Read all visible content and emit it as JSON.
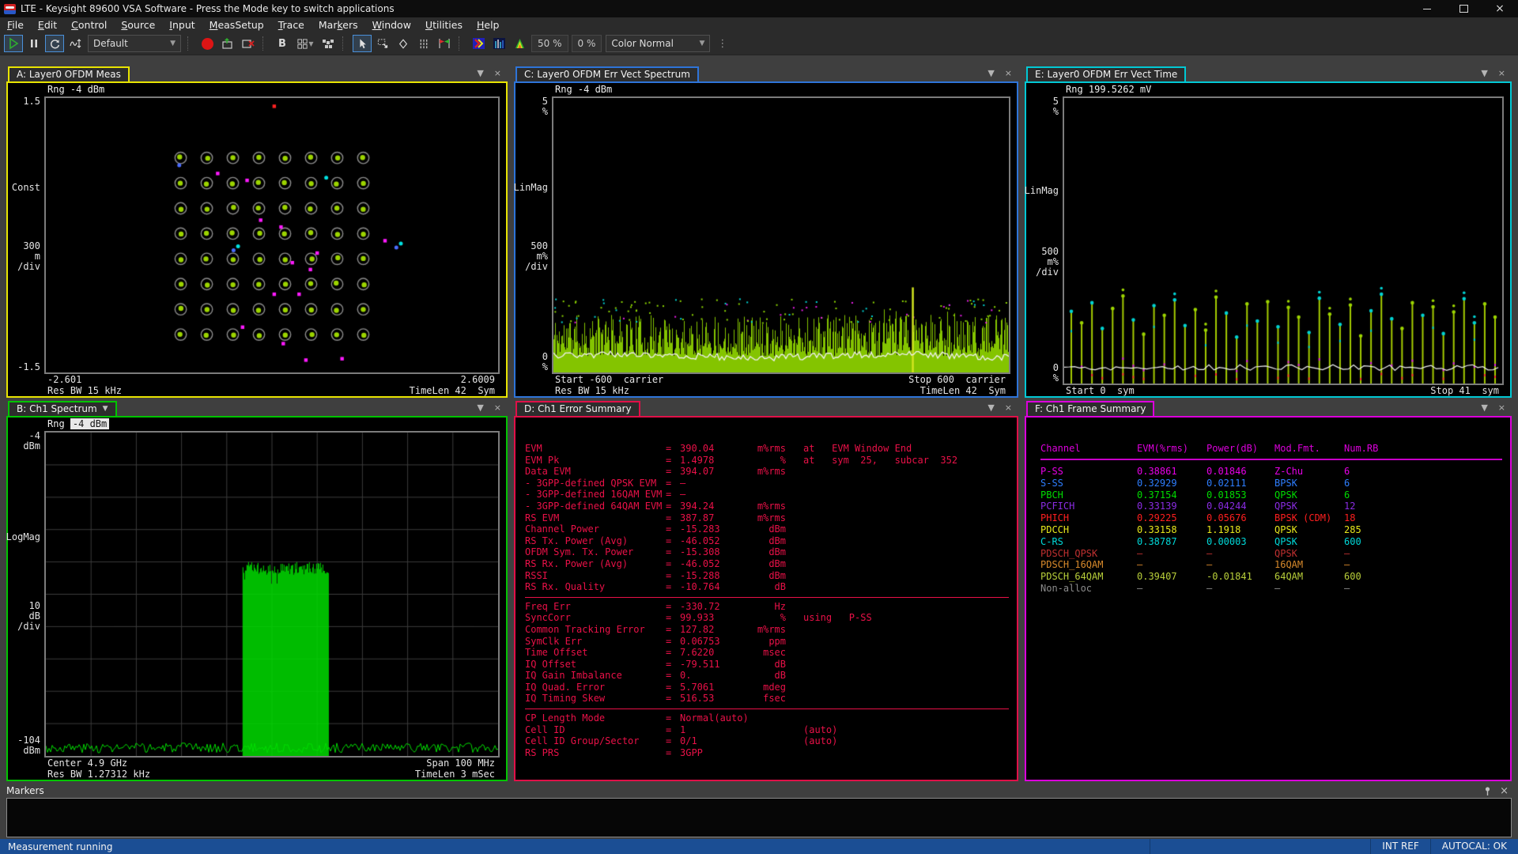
{
  "window": {
    "title": "LTE - Keysight 89600 VSA Software - Press the Mode key to switch applications"
  },
  "menu": {
    "items": [
      {
        "label": "File",
        "u": 0
      },
      {
        "label": "Edit",
        "u": 0
      },
      {
        "label": "Control",
        "u": 0
      },
      {
        "label": "Source",
        "u": 0
      },
      {
        "label": "Input",
        "u": 0
      },
      {
        "label": "MeasSetup",
        "u": 0
      },
      {
        "label": "Trace",
        "u": 0
      },
      {
        "label": "Markers",
        "u": 3
      },
      {
        "label": "Window",
        "u": 0
      },
      {
        "label": "Utilities",
        "u": 0
      },
      {
        "label": "Help",
        "u": 0
      }
    ]
  },
  "toolbar": {
    "preset": "Default",
    "bold_label": "B",
    "avg_pct": "50 %",
    "overlap_pct": "0 %",
    "color_mode": "Color Normal"
  },
  "panels": {
    "a": {
      "tab": "A: Layer0 OFDM Meas",
      "border": "#e8e400",
      "rng": "Rng -4 dBm",
      "y_top": "1.5",
      "y_name": "Const",
      "y_div": [
        "300",
        "m",
        "/div"
      ],
      "y_bottom": "-1.5",
      "x1_left": "-2.601",
      "x1_right": "2.6009",
      "x2_left": "Res BW 15 kHz",
      "x2_right": "TimeLen 42  Sym"
    },
    "b": {
      "tab": "B: Ch1 Spectrum",
      "border": "#00c400",
      "rng_label": "Rng ",
      "rng_value": "-4 dBm",
      "y_top": [
        "-4",
        "dBm"
      ],
      "y_name": "LogMag",
      "y_div": [
        "10",
        "dB",
        "/div"
      ],
      "y_bottom": [
        "-104",
        "dBm"
      ],
      "x1_left": "Center 4.9 GHz",
      "x1_right": "Span 100 MHz",
      "x2_left": "Res BW 1.27312 kHz",
      "x2_right": "TimeLen 3 mSec"
    },
    "c": {
      "tab": "C: Layer0 OFDM Err Vect Spectrum",
      "border": "#2e74d8",
      "rng": "Rng -4 dBm",
      "y_top": [
        "5",
        "%"
      ],
      "y_name": "LinMag",
      "y_div": [
        "500",
        "m%",
        "/div"
      ],
      "y_bottom": [
        "0",
        "%"
      ],
      "x1_left": "Start -600  carrier",
      "x1_right": "Stop 600  carrier",
      "x2_left": "Res BW 15 kHz",
      "x2_right": "TimeLen 42  Sym"
    },
    "d": {
      "tab": "D: Ch1 Error Summary",
      "border": "#e01048",
      "rows": [
        {
          "label": "EVM",
          "value": "390.04",
          "unit": "m%rms",
          "extra": "at   EVM Window End"
        },
        {
          "label": "EVM Pk",
          "value": "1.4978",
          "unit": "%",
          "extra": "at   sym  25,   subcar  352"
        },
        {
          "label": "Data EVM",
          "value": "394.07",
          "unit": "m%rms",
          "extra": ""
        },
        {
          "label": "- 3GPP-defined QPSK EVM",
          "value": "—",
          "unit": "",
          "extra": ""
        },
        {
          "label": "- 3GPP-defined 16QAM EVM",
          "value": "—",
          "unit": "",
          "extra": ""
        },
        {
          "label": "- 3GPP-defined 64QAM EVM",
          "value": "394.24",
          "unit": "m%rms",
          "extra": ""
        },
        {
          "label": "RS EVM",
          "value": "387.87",
          "unit": "m%rms",
          "extra": ""
        },
        {
          "label": "Channel Power",
          "value": "-15.283",
          "unit": "dBm",
          "extra": ""
        },
        {
          "label": "RS Tx. Power (Avg)",
          "value": "-46.052",
          "unit": "dBm",
          "extra": ""
        },
        {
          "label": "OFDM Sym. Tx. Power",
          "value": "-15.308",
          "unit": "dBm",
          "extra": ""
        },
        {
          "label": "RS Rx. Power (Avg)",
          "value": "-46.052",
          "unit": "dBm",
          "extra": ""
        },
        {
          "label": "RSSI",
          "value": "-15.288",
          "unit": "dBm",
          "extra": ""
        },
        {
          "label": "RS Rx. Quality",
          "value": "-10.764",
          "unit": "dB",
          "extra": ""
        },
        {
          "label": "Freq Err",
          "value": "-330.72",
          "unit": "Hz",
          "extra": ""
        },
        {
          "label": "SyncCorr",
          "value": "99.933",
          "unit": "%",
          "extra": "using   P-SS"
        },
        {
          "label": "Common Tracking Error",
          "value": "127.82",
          "unit": "m%rms",
          "extra": ""
        },
        {
          "label": "SymClk Err",
          "value": "0.06753",
          "unit": "ppm",
          "extra": ""
        },
        {
          "label": "Time Offset",
          "value": "7.6220",
          "unit": "msec",
          "extra": ""
        },
        {
          "label": "IQ Offset",
          "value": "-79.511",
          "unit": "dB",
          "extra": ""
        },
        {
          "label": "IQ Gain Imbalance",
          "value": "0.",
          "unit": "dB",
          "extra": ""
        },
        {
          "label": "IQ Quad. Error",
          "value": "5.7061",
          "unit": "mdeg",
          "extra": ""
        },
        {
          "label": "IQ Timing Skew",
          "value": "516.53",
          "unit": "fsec",
          "extra": ""
        },
        {
          "label": "CP Length Mode",
          "value": "Normal(auto)",
          "unit": "",
          "extra": ""
        },
        {
          "label": "Cell ID",
          "value": "1",
          "unit": "",
          "extra": "(auto)"
        },
        {
          "label": "Cell ID Group/Sector",
          "value": "0/1",
          "unit": "",
          "extra": "(auto)"
        },
        {
          "label": "RS PRS",
          "value": "3GPP",
          "unit": "",
          "extra": ""
        }
      ],
      "separators_after": [
        12,
        21
      ]
    },
    "e": {
      "tab": "E: Layer0 OFDM Err Vect Time",
      "border": "#00c8d4",
      "rng": "Rng 199.5262 mV",
      "y_top": [
        "5",
        "%"
      ],
      "y_name": "LinMag",
      "y_div": [
        "500",
        "m%",
        "/div"
      ],
      "y_bottom": [
        "0",
        "%"
      ],
      "x1_left": "Start 0  sym",
      "x1_right": "Stop 41  sym"
    },
    "f": {
      "tab": "F: Ch1 Frame Summary",
      "border": "#dc00dc",
      "headers": [
        "Channel",
        "EVM(%rms)",
        "Power(dB)",
        "Mod.Fmt.",
        "Num.RB"
      ],
      "rows": [
        {
          "channel": "P-SS",
          "evm": "0.38861",
          "power": "0.01846",
          "mod": "Z-Chu",
          "rb": "6",
          "color": "#e800e8"
        },
        {
          "channel": "S-SS",
          "evm": "0.32929",
          "power": "0.02111",
          "mod": "BPSK",
          "rb": "6",
          "color": "#2e7eff"
        },
        {
          "channel": "PBCH",
          "evm": "0.37154",
          "power": "0.01853",
          "mod": "QPSK",
          "rb": "6",
          "color": "#00dc00"
        },
        {
          "channel": "PCFICH",
          "evm": "0.33139",
          "power": "0.04244",
          "mod": "QPSK",
          "rb": "12",
          "color": "#8a2be2"
        },
        {
          "channel": "PHICH",
          "evm": "0.29225",
          "power": "0.05676",
          "mod": "BPSK (CDM)",
          "rb": "18",
          "color": "#ff1f1f"
        },
        {
          "channel": "PDCCH",
          "evm": "0.33158",
          "power": "1.1918",
          "mod": "QPSK",
          "rb": "285",
          "color": "#e8e81c"
        },
        {
          "channel": "C-RS",
          "evm": "0.38787",
          "power": "0.00003",
          "mod": "QPSK",
          "rb": "600",
          "color": "#00d8d8"
        },
        {
          "channel": "PDSCH_QPSK",
          "evm": "—",
          "power": "—",
          "mod": "QPSK",
          "rb": "—",
          "color": "#c03030"
        },
        {
          "channel": "PDSCH_16QAM",
          "evm": "—",
          "power": "—",
          "mod": "16QAM",
          "rb": "—",
          "color": "#d98a2b"
        },
        {
          "channel": "PDSCH_64QAM",
          "evm": "0.39407",
          "power": "-0.01841",
          "mod": "64QAM",
          "rb": "600",
          "color": "#b9cf3a"
        },
        {
          "channel": "Non-alloc",
          "evm": "—",
          "power": "—",
          "mod": "—",
          "rb": "—",
          "color": "#8c8c8c"
        }
      ]
    }
  },
  "markers_panel": {
    "title": "Markers"
  },
  "status_bar": {
    "left": "Measurement running",
    "ref": "INT REF",
    "autocal": "AUTOCAL: OK"
  },
  "chart_data": [
    {
      "id": "constellation",
      "type": "constellation",
      "title": "A: Layer0 OFDM Meas",
      "format": "64QAM",
      "x_range": [
        -2.601,
        2.6009
      ],
      "y_top": 1.5,
      "units_per_div": 0.3,
      "range": "-4 dBm",
      "res_bw": "15 kHz",
      "time_len": "42 Sym",
      "qam_levels": [
        -7,
        -5,
        -3,
        -1,
        1,
        3,
        5,
        7
      ],
      "ideal_amplitude": 1.05,
      "ideal_color": "#9cd400",
      "ring_color": "#8d8d8d",
      "seed": 7,
      "stray_points": [
        {
          "x": 0.505,
          "y": 0.03,
          "c": "#ff2222",
          "s": "sq"
        },
        {
          "x": 0.38,
          "y": 0.275,
          "c": "#ff1aff",
          "s": "sq"
        },
        {
          "x": 0.445,
          "y": 0.3,
          "c": "#ff1aff",
          "s": "sq"
        },
        {
          "x": 0.475,
          "y": 0.445,
          "c": "#ff1aff",
          "s": "sq"
        },
        {
          "x": 0.52,
          "y": 0.47,
          "c": "#ff1aff",
          "s": "sq"
        },
        {
          "x": 0.6,
          "y": 0.565,
          "c": "#ff1aff",
          "s": "sq"
        },
        {
          "x": 0.545,
          "y": 0.6,
          "c": "#ff1aff",
          "s": "sq"
        },
        {
          "x": 0.585,
          "y": 0.625,
          "c": "#ff1aff",
          "s": "sq"
        },
        {
          "x": 0.505,
          "y": 0.715,
          "c": "#ff1aff",
          "s": "sq"
        },
        {
          "x": 0.56,
          "y": 0.715,
          "c": "#ff1aff",
          "s": "sq"
        },
        {
          "x": 0.435,
          "y": 0.835,
          "c": "#ff1aff",
          "s": "sq"
        },
        {
          "x": 0.525,
          "y": 0.895,
          "c": "#ff1aff",
          "s": "sq"
        },
        {
          "x": 0.575,
          "y": 0.955,
          "c": "#ff1aff",
          "s": "sq"
        },
        {
          "x": 0.655,
          "y": 0.95,
          "c": "#ff1aff",
          "s": "sq"
        },
        {
          "x": 0.75,
          "y": 0.52,
          "c": "#ff1aff",
          "s": "sq"
        },
        {
          "x": 0.295,
          "y": 0.245,
          "c": "#4a6cff",
          "s": "dot"
        },
        {
          "x": 0.415,
          "y": 0.555,
          "c": "#4a6cff",
          "s": "dot"
        },
        {
          "x": 0.775,
          "y": 0.545,
          "c": "#4a6cff",
          "s": "dot"
        },
        {
          "x": 0.425,
          "y": 0.54,
          "c": "#00e0e0",
          "s": "dot"
        },
        {
          "x": 0.785,
          "y": 0.53,
          "c": "#00e0e0",
          "s": "dot"
        },
        {
          "x": 0.62,
          "y": 0.29,
          "c": "#00e0e0",
          "s": "dot"
        }
      ]
    },
    {
      "id": "evm_spectrum",
      "type": "evm_area",
      "title": "C: Layer0 OFDM Err Vect Spectrum",
      "x_axis": {
        "start": -600,
        "stop": 600,
        "label": "carrier"
      },
      "ylim": [
        0,
        5
      ],
      "y_unit": "%",
      "range": "-4 dBm",
      "res_bw": "15 kHz",
      "time_len": "42 Sym",
      "band_min": 0.3,
      "band_max": 1.05,
      "white_line_mean": 0.3,
      "dots_max": 1.35,
      "spike": {
        "x_frac": 0.787,
        "value": 1.55
      },
      "seed": 11,
      "colors": {
        "band": "#84c400",
        "dots": [
          "#8cd400",
          "#00d2d2",
          "#e81ee8"
        ],
        "spike": "#d2e51e",
        "line": "#f0f0f0"
      }
    },
    {
      "id": "evm_time",
      "type": "evm_bars",
      "title": "E: Layer0 OFDM Err Vect Time",
      "x_axis": {
        "start": 0,
        "stop": 41,
        "label": "sym"
      },
      "ylim": [
        0,
        5
      ],
      "y_unit": "%",
      "range": "199.5262 mV",
      "white_line_mean": 0.28,
      "seed": 5,
      "values": [
        1.25,
        1.05,
        1.4,
        0.95,
        1.3,
        1.52,
        1.1,
        0.85,
        1.35,
        1.18,
        1.45,
        1.0,
        1.28,
        0.92,
        1.5,
        1.22,
        0.8,
        1.38,
        1.08,
        1.42,
        0.98,
        1.32,
        1.15,
        0.88,
        1.48,
        1.2,
        1.02,
        1.36,
        0.82,
        1.26,
        1.55,
        1.12,
        0.95,
        1.4,
        1.18,
        1.33,
        0.86,
        1.24,
        1.47,
        1.05,
        1.38,
        1.15
      ],
      "dot_pattern": "cgccggcgcgccgggccgcgcggccgcggcccggcgcgccgg",
      "colors": {
        "bar": "#a4cc00",
        "dot_c": "#00d2d2",
        "dot_g": "#9cd400",
        "accent_m": "#e01ee0",
        "accent_r": "#ff3030",
        "line": "#f0f0f0"
      }
    },
    {
      "id": "spectrum",
      "type": "spectrum",
      "title": "B: Ch1 Spectrum",
      "center": "4.9 GHz",
      "span": "100 MHz",
      "ref_level_dbm": -4,
      "bottom_dbm": -104,
      "db_per_div": 10,
      "res_bw": "1.27312 kHz",
      "time_len": "3 mSec",
      "grid": true,
      "signal": {
        "x_from_frac": 0.435,
        "x_to_frac": 0.625,
        "top_dbm": -46
      },
      "noise_floor_dbm": -101.5,
      "seed": 3,
      "colors": {
        "trace": "#00dc00",
        "grid": "#3c3c3c"
      }
    }
  ]
}
